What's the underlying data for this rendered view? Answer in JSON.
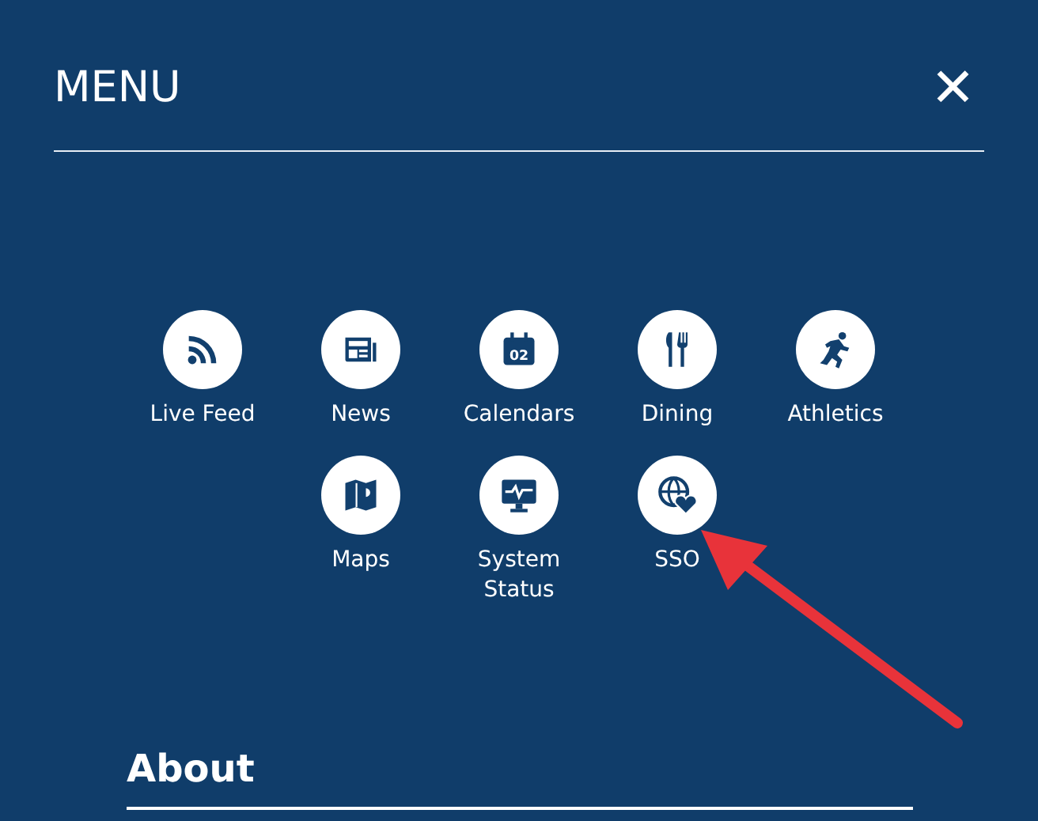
{
  "header": {
    "title": "MENU",
    "close": "✕"
  },
  "items": [
    {
      "label": "Live Feed"
    },
    {
      "label": "News"
    },
    {
      "label": "Calendars",
      "icon_text": "02"
    },
    {
      "label": "Dining"
    },
    {
      "label": "Athletics"
    },
    {
      "label": "Maps"
    },
    {
      "label": "System Status"
    },
    {
      "label": "SSO"
    }
  ],
  "section": {
    "heading": "About"
  }
}
